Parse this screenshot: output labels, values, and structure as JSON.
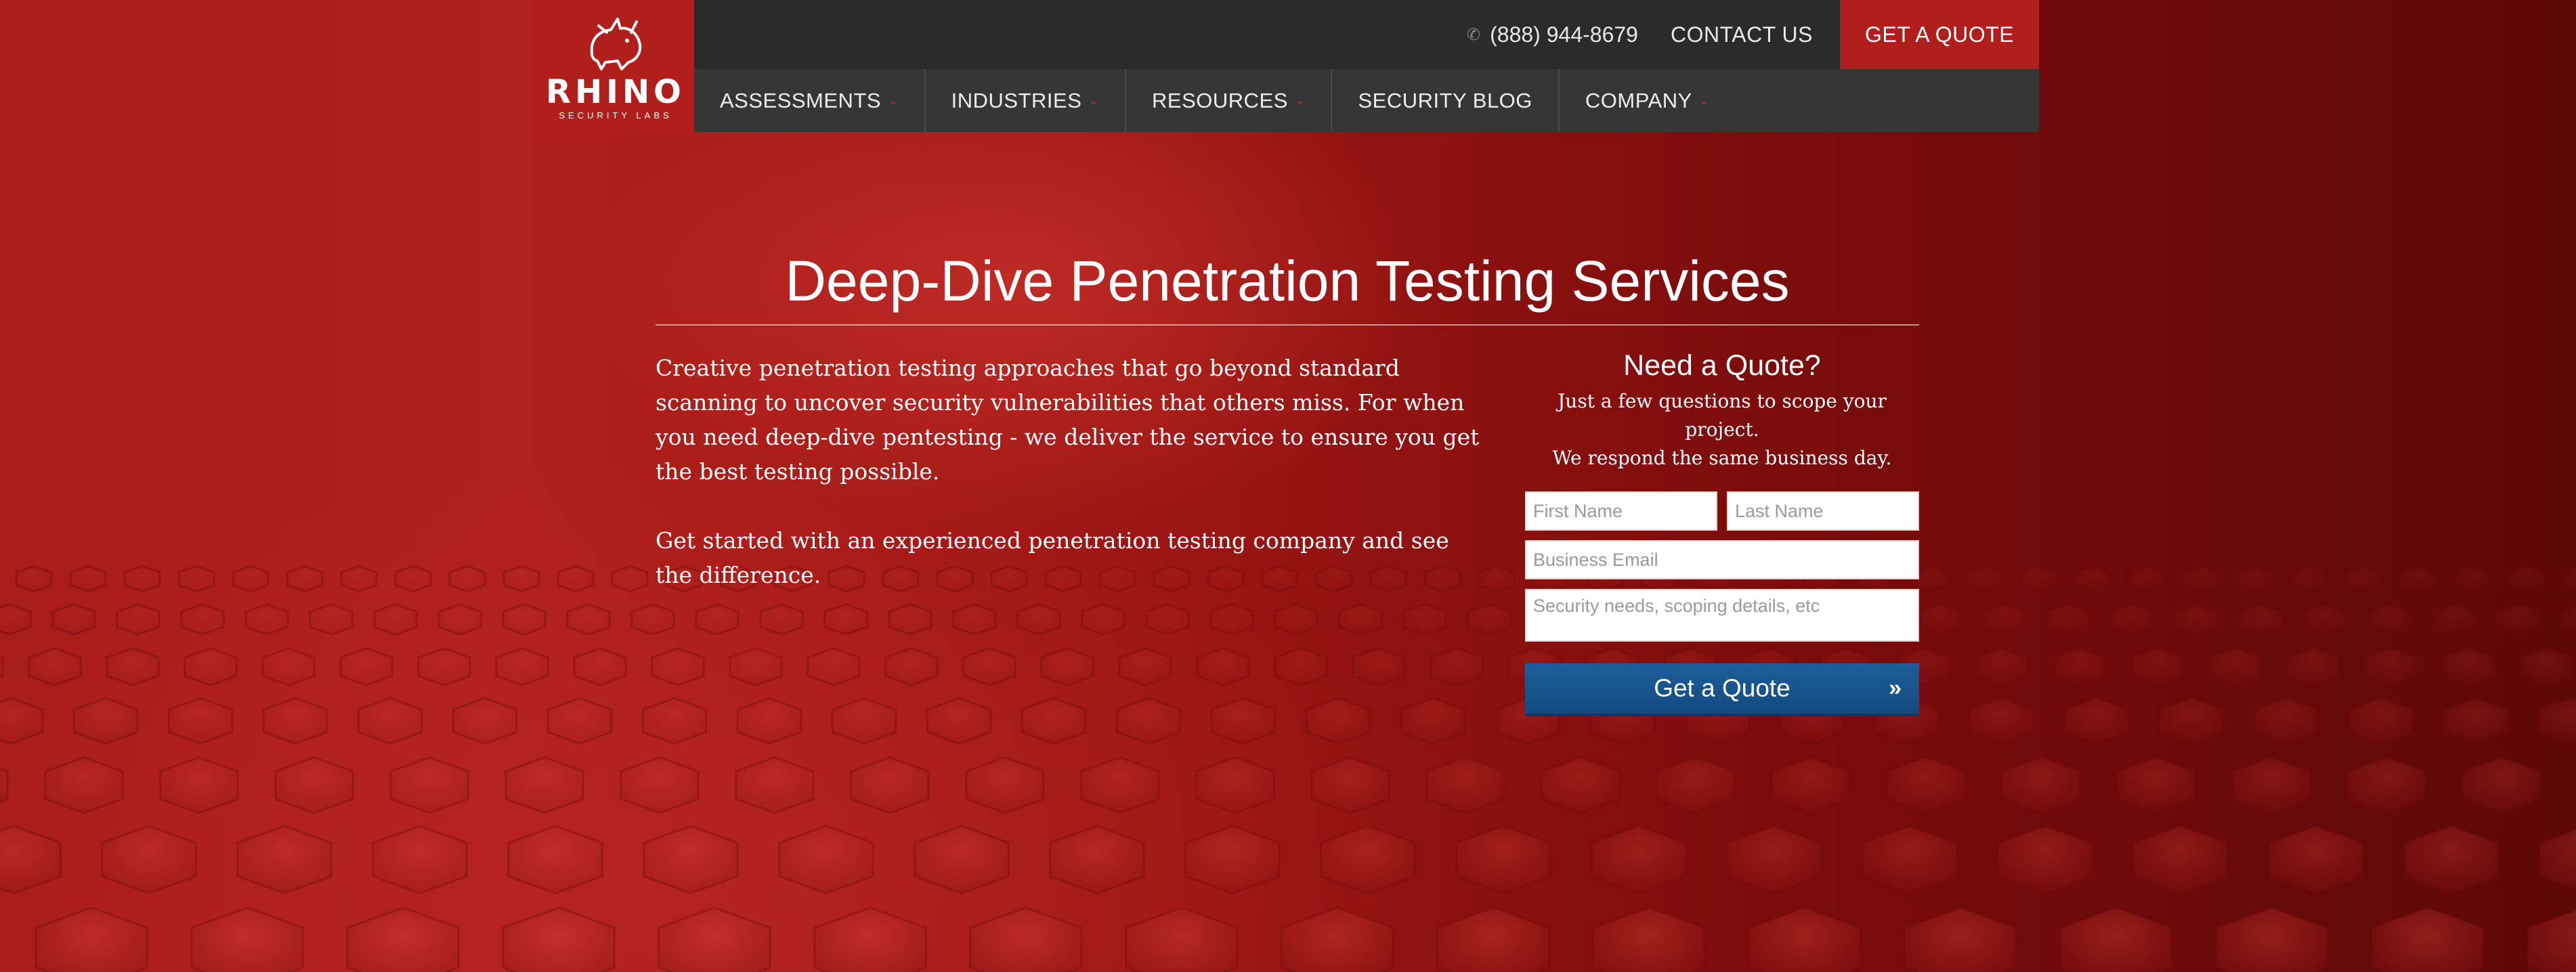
{
  "colors": {
    "brand_red": "#b01f1b",
    "topbar": "#2b2b2b",
    "navbar": "#363636",
    "submit_blue": "#1d5e9a"
  },
  "header": {
    "logo_text": "RHINO",
    "logo_sub": "SECURITY LABS",
    "logo_icon": "rhino-icon",
    "phone_icon": "phone-icon",
    "phone": "(888) 944-8679",
    "contact": "CONTACT US",
    "quote": "GET A QUOTE"
  },
  "nav": {
    "items": [
      {
        "label": "ASSESSMENTS",
        "dropdown": true
      },
      {
        "label": "INDUSTRIES",
        "dropdown": true
      },
      {
        "label": "RESOURCES",
        "dropdown": true
      },
      {
        "label": "SECURITY BLOG",
        "dropdown": false
      },
      {
        "label": "COMPANY",
        "dropdown": true
      }
    ],
    "caret": "⌄"
  },
  "hero": {
    "title": "Deep-Dive Penetration Testing Services",
    "paragraph1": "Creative penetration testing approaches that go beyond standard scanning to uncover security vulnerabilities that others miss. For when you need deep-dive pentesting - we deliver the service to ensure you get the best testing possible.",
    "paragraph2": "Get started with an experienced penetration testing company and see the difference."
  },
  "form": {
    "title": "Need a Quote?",
    "subtitle_line1": "Just a few questions to scope your project.",
    "subtitle_line2": "We respond the same business day.",
    "first_name_placeholder": "First Name",
    "last_name_placeholder": "Last Name",
    "email_placeholder": "Business Email",
    "details_placeholder": "Security needs, scoping details, etc",
    "submit_label": "Get a Quote",
    "submit_icon": "»"
  }
}
